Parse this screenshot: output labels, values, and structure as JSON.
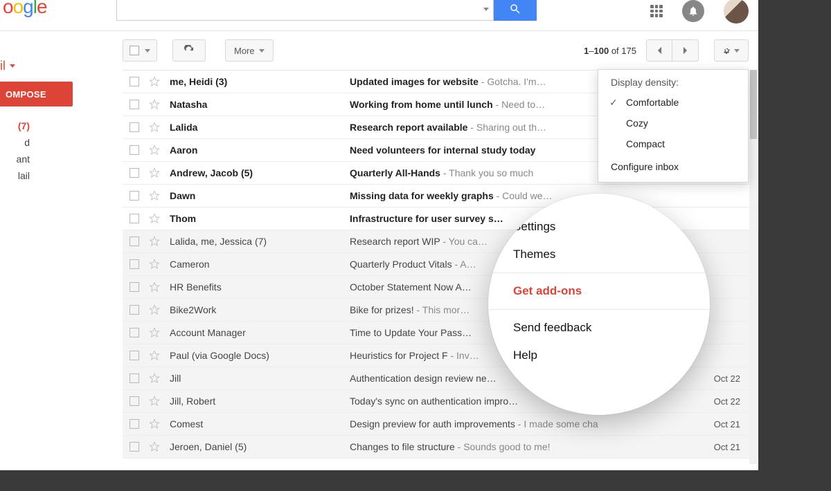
{
  "header": {
    "logo_text": "oogle",
    "search_placeholder": "",
    "search_value": ""
  },
  "sidebar": {
    "brand": "il",
    "compose_label": "OMPOSE",
    "items": [
      {
        "label": "(7)",
        "active": true
      },
      {
        "label": "d",
        "active": false
      },
      {
        "label": "ant",
        "active": false
      },
      {
        "label": "lail",
        "active": false
      }
    ]
  },
  "toolbar": {
    "more_label": "More",
    "pager_from": "1",
    "pager_to": "100",
    "pager_of_label": "of",
    "pager_total": "175"
  },
  "settings_menu_small": {
    "header": "Display density:",
    "options": [
      {
        "label": "Comfortable",
        "selected": true
      },
      {
        "label": "Cozy",
        "selected": false
      },
      {
        "label": "Compact",
        "selected": false
      }
    ],
    "configure_label": "Configure inbox"
  },
  "settings_menu_large": {
    "items_top": [
      "Settings",
      "Themes"
    ],
    "highlight": "Get add-ons",
    "items_bottom": [
      "Send feedback",
      "Help"
    ]
  },
  "messages": [
    {
      "unread": true,
      "sender": "me, Heidi (3)",
      "subject": "Updated images for website",
      "snippet": " - Gotcha. I'm…",
      "date": ""
    },
    {
      "unread": true,
      "sender": "Natasha",
      "subject": "Working from home until lunch",
      "snippet": " - Need to…",
      "date": ""
    },
    {
      "unread": true,
      "sender": "Lalida",
      "subject": "Research report available",
      "snippet": " - Sharing out th…",
      "date": ""
    },
    {
      "unread": true,
      "sender": "Aaron",
      "subject": "Need volunteers for internal study today",
      "snippet": "",
      "date": ""
    },
    {
      "unread": true,
      "sender": "Andrew, Jacob (5)",
      "subject": "Quarterly All-Hands",
      "snippet": " - Thank you so much",
      "date": ""
    },
    {
      "unread": true,
      "sender": "Dawn",
      "subject": "Missing data for weekly graphs",
      "snippet": " - Could we…",
      "date": ""
    },
    {
      "unread": true,
      "sender": "Thom",
      "subject": "Infrastructure for user survey s…",
      "snippet": "",
      "date": ""
    },
    {
      "unread": false,
      "sender": "Lalida, me, Jessica (7)",
      "subject": "Research report WIP",
      "snippet": " - You ca…",
      "date": ""
    },
    {
      "unread": false,
      "sender": "Cameron",
      "subject": "Quarterly Product Vitals",
      "snippet": " - A…",
      "date": ""
    },
    {
      "unread": false,
      "sender": "HR Benefits",
      "subject": "October Statement Now A…",
      "snippet": "",
      "date": ""
    },
    {
      "unread": false,
      "sender": "Bike2Work",
      "subject": "Bike for prizes!",
      "snippet": " - This mor…",
      "date": ""
    },
    {
      "unread": false,
      "sender": "Account Manager",
      "subject": "Time to Update Your Pass…",
      "snippet": "",
      "date": ""
    },
    {
      "unread": false,
      "sender": "Paul (via Google Docs)",
      "subject": "Heuristics for Project F",
      "snippet": " - Inv…",
      "date": ""
    },
    {
      "unread": false,
      "sender": "Jill",
      "subject": "Authentication design review ne…",
      "snippet": "",
      "date": "Oct 22"
    },
    {
      "unread": false,
      "sender": "Jill, Robert",
      "subject": "Today's sync on authentication impro…",
      "snippet": "",
      "date": "Oct 22"
    },
    {
      "unread": false,
      "sender": "Comest",
      "subject": "Design preview for auth improvements",
      "snippet": " - I made some cha",
      "date": "Oct 21"
    },
    {
      "unread": false,
      "sender": "Jeroen, Daniel (5)",
      "subject": "Changes to file structure",
      "snippet": " - Sounds good to me!",
      "date": "Oct 21"
    }
  ]
}
